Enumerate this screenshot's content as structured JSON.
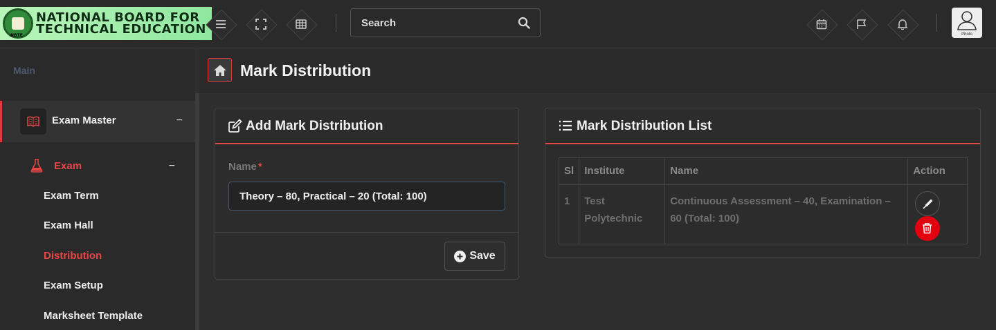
{
  "header": {
    "logo_line1": "NATIONAL BOARD FOR",
    "logo_line2": "TECHNICAL EDUCATION",
    "logo_mini": "NBTE",
    "search_placeholder": "Search",
    "avatar_caption": "Photo"
  },
  "sidebar": {
    "section_label": "Main",
    "group": {
      "label": "Exam Master",
      "toggle": "−"
    },
    "subgroup": {
      "label": "Exam",
      "toggle": "−"
    },
    "items": [
      "Exam Term",
      "Exam Hall",
      "Distribution",
      "Exam Setup",
      "Marksheet Template"
    ],
    "active_item": "Distribution"
  },
  "page": {
    "title": "Mark Distribution"
  },
  "form": {
    "title": "Add Mark Distribution",
    "name_label": "Name",
    "required_mark": "*",
    "name_value": "Theory – 80, Practical – 20 (Total: 100)",
    "save_label": "Save"
  },
  "list": {
    "title": "Mark Distribution List",
    "columns": [
      "Sl",
      "Institute",
      "Name",
      "Action"
    ],
    "rows": [
      {
        "sl": "1",
        "institute": "Test Polytechnic",
        "name": "Continuous Assessment – 40, Examination – 60 (Total: 100)"
      }
    ]
  },
  "colors": {
    "accent": "#e04848",
    "delete": "#e3000f",
    "background": "#2e2e2e"
  }
}
